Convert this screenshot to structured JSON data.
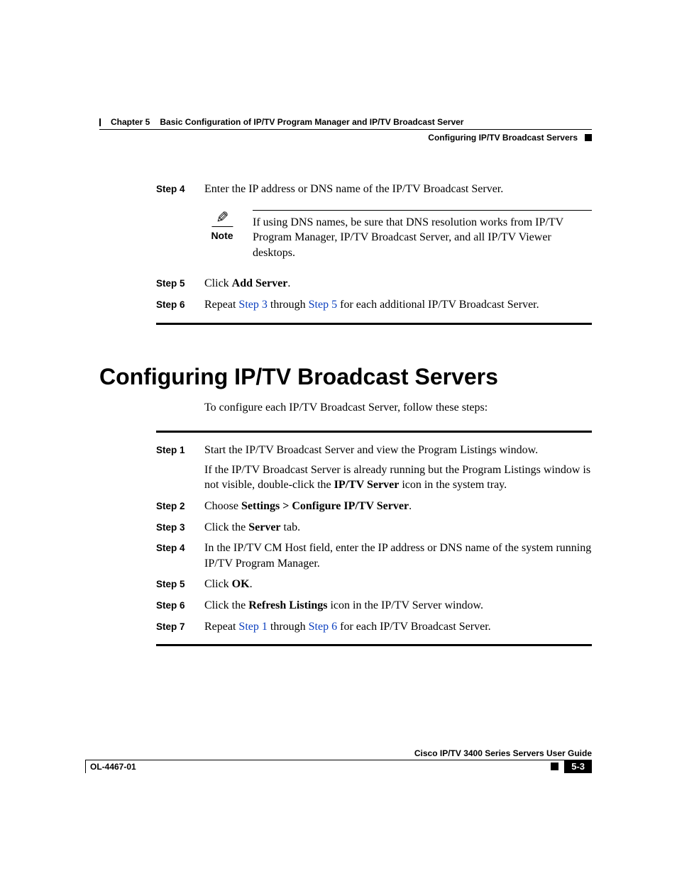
{
  "header": {
    "chapter_label": "Chapter 5",
    "chapter_title": "Basic Configuration of IP/TV Program Manager and IP/TV Broadcast Server",
    "section_title": "Configuring IP/TV Broadcast Servers"
  },
  "top_steps": {
    "step4": {
      "label": "Step 4",
      "text": "Enter the IP address or DNS name of the IP/TV Broadcast Server."
    },
    "note": {
      "label": "Note",
      "text": "If using DNS names, be sure that DNS resolution works from IP/TV Program Manager, IP/TV Broadcast Server, and all IP/TV Viewer desktops."
    },
    "step5": {
      "label": "Step 5",
      "pre": "Click ",
      "bold": "Add Server",
      "post": "."
    },
    "step6": {
      "label": "Step 6",
      "pre": "Repeat ",
      "link1": "Step 3",
      "mid": " through ",
      "link2": "Step 5",
      "post": " for each additional IP/TV Broadcast Server."
    }
  },
  "heading": "Configuring IP/TV Broadcast Servers",
  "intro": "To configure each IP/TV Broadcast Server, follow these steps:",
  "steps2": {
    "s1": {
      "label": "Step 1",
      "line1": "Start the IP/TV Broadcast Server and view the Program Listings window.",
      "line2_pre": "If the IP/TV Broadcast Server is already running but the Program Listings window is not visible, double-click the ",
      "line2_bold": "IP/TV Server",
      "line2_post": " icon in the system tray."
    },
    "s2": {
      "label": "Step 2",
      "pre": "Choose ",
      "bold": "Settings > Configure IP/TV Server",
      "post": "."
    },
    "s3": {
      "label": "Step 3",
      "pre": "Click the ",
      "bold": "Server",
      "post": " tab."
    },
    "s4": {
      "label": "Step 4",
      "text": "In the IP/TV CM Host field, enter the IP address or DNS name of the system running IP/TV Program Manager."
    },
    "s5": {
      "label": "Step 5",
      "pre": "Click ",
      "bold": "OK",
      "post": "."
    },
    "s6": {
      "label": "Step 6",
      "pre": "Click the ",
      "bold": "Refresh Listings",
      "post": " icon in the IP/TV Server window."
    },
    "s7": {
      "label": "Step 7",
      "pre": "Repeat ",
      "link1": "Step 1",
      "mid": " through ",
      "link2": "Step 6",
      "post": " for each IP/TV Broadcast Server."
    }
  },
  "footer": {
    "book_title": "Cisco IP/TV 3400 Series Servers User Guide",
    "doc_id": "OL-4467-01",
    "page_num": "5-3"
  }
}
